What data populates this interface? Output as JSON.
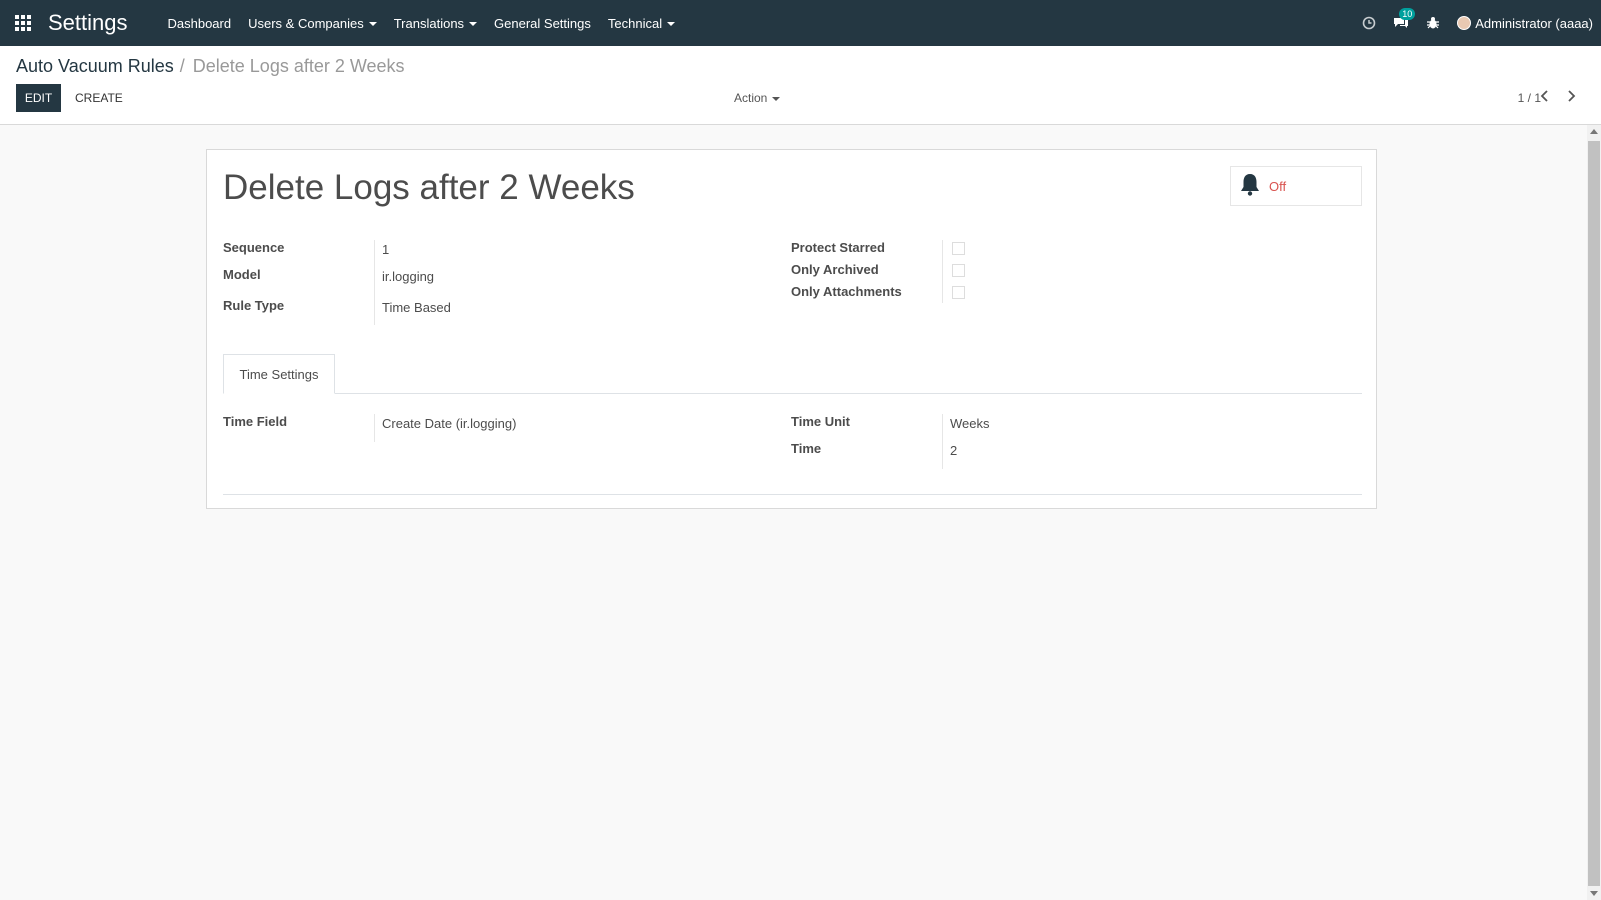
{
  "navbar": {
    "brand": "Settings",
    "menu": [
      {
        "label": "Dashboard",
        "dropdown": false
      },
      {
        "label": "Users & Companies",
        "dropdown": true
      },
      {
        "label": "Translations",
        "dropdown": true
      },
      {
        "label": "General Settings",
        "dropdown": false
      },
      {
        "label": "Technical",
        "dropdown": true
      }
    ],
    "messages_badge": "10",
    "user": "Administrator (aaaa)"
  },
  "breadcrumb": {
    "parent": "Auto Vacuum Rules",
    "separator": "/",
    "current": "Delete Logs after 2 Weeks"
  },
  "buttons": {
    "edit": "EDIT",
    "create": "CREATE",
    "action": "Action"
  },
  "pager": {
    "value": "1 / 1"
  },
  "record": {
    "title": "Delete Logs after 2 Weeks",
    "active_status": "Off",
    "fields_left": [
      {
        "label": "Sequence",
        "value": "1"
      },
      {
        "label": "Model",
        "value": "ir.logging"
      },
      {
        "label": "Rule Type",
        "value": "Time Based"
      }
    ],
    "fields_right": [
      {
        "label": "Protect Starred",
        "checked": false
      },
      {
        "label": "Only Archived",
        "checked": false
      },
      {
        "label": "Only Attachments",
        "checked": false
      }
    ],
    "tab": "Time Settings",
    "time_field": {
      "label": "Time Field",
      "value": "Create Date (ir.logging)"
    },
    "time_unit": {
      "label": "Time Unit",
      "value": "Weeks"
    },
    "time": {
      "label": "Time",
      "value": "2"
    }
  },
  "colors": {
    "navbar": "#243742",
    "status_off": "#d9534f",
    "background": "#f9f9f9"
  }
}
